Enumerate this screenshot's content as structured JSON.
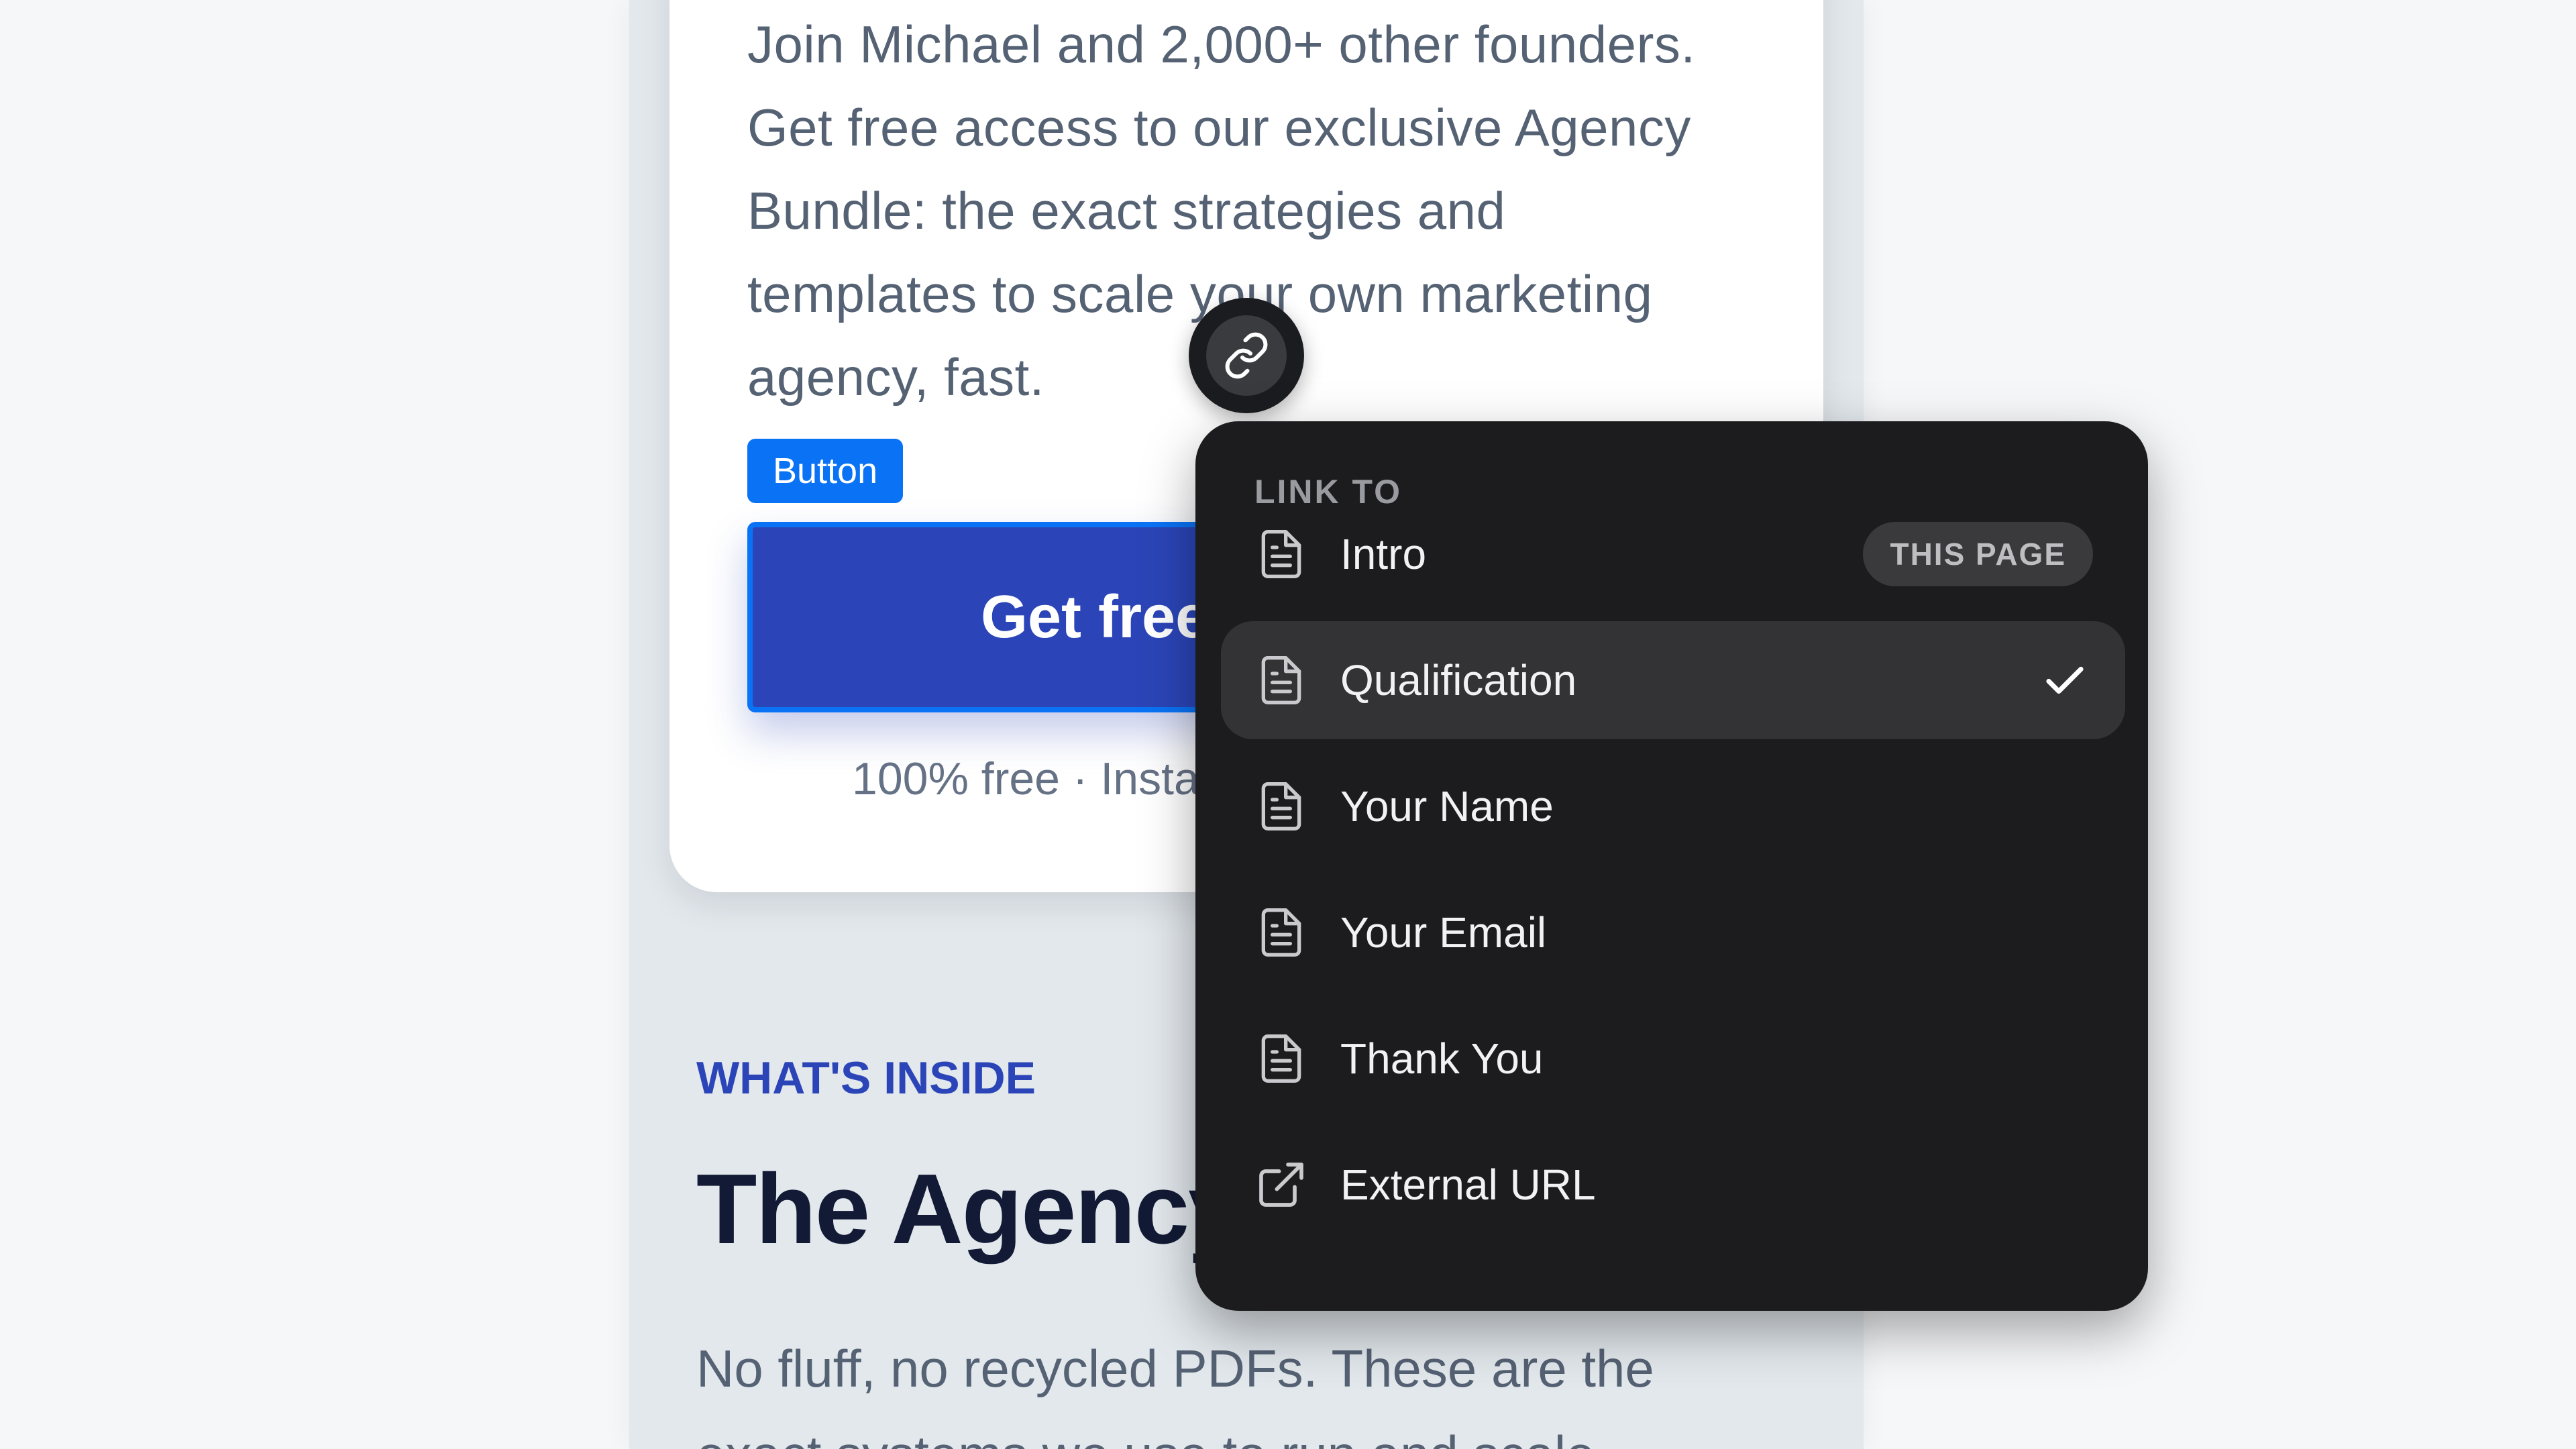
{
  "hero": {
    "text_lines": [
      "Join Michael and 2,000+ other founders.",
      "Get free access to our exclusive Agency",
      "Bundle: the exact strategies and",
      "templates to scale your own marketing",
      "agency, fast."
    ],
    "element_tag": "Button",
    "cta_label": "Get free",
    "cta_subtext": "100% free · Insta"
  },
  "section": {
    "eyebrow": "WHAT'S INSIDE",
    "heading": "The Agency",
    "body_lines": [
      "No fluff, no recycled PDFs. These are the",
      "exact systems we use to run and scale"
    ]
  },
  "link_menu": {
    "title": "LINK TO",
    "items": [
      {
        "label": "Intro",
        "icon": "document-icon",
        "badge": "THIS PAGE"
      },
      {
        "label": "Qualification",
        "icon": "document-icon",
        "selected": true
      },
      {
        "label": "Your Name",
        "icon": "document-icon"
      },
      {
        "label": "Your Email",
        "icon": "document-icon"
      },
      {
        "label": "Thank You",
        "icon": "document-icon"
      },
      {
        "label": "External URL",
        "icon": "external-link-icon"
      }
    ]
  },
  "colors": {
    "accent_blue": "#0a73f5",
    "cta_blue": "#2b45b8",
    "menu_bg": "#1c1c1e"
  }
}
